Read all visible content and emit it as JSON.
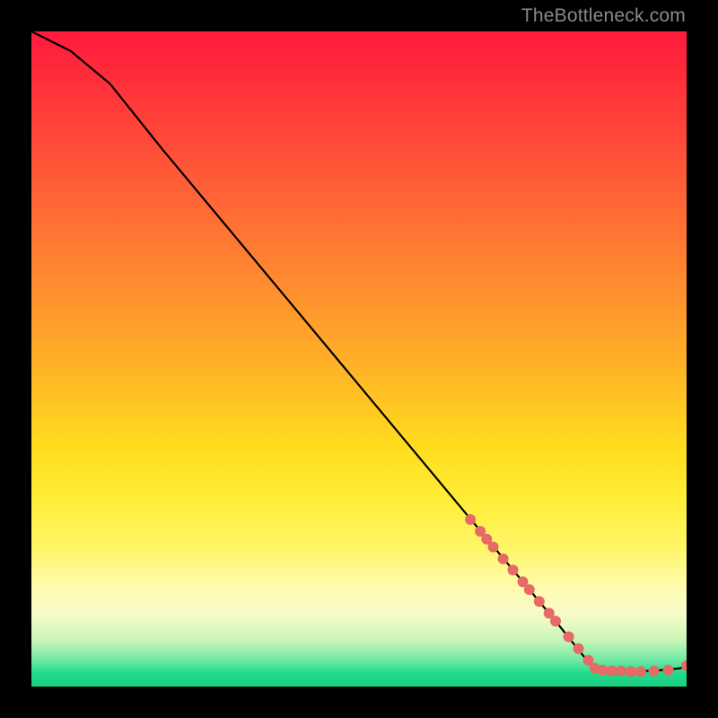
{
  "watermark": "TheBottleneck.com",
  "chart_data": {
    "type": "line",
    "title": "",
    "xlabel": "",
    "ylabel": "",
    "xlim": [
      0,
      100
    ],
    "ylim": [
      0,
      100
    ],
    "curve": [
      {
        "x": 0,
        "y": 100
      },
      {
        "x": 6,
        "y": 97
      },
      {
        "x": 12,
        "y": 92
      },
      {
        "x": 20,
        "y": 82
      },
      {
        "x": 30,
        "y": 70
      },
      {
        "x": 40,
        "y": 58
      },
      {
        "x": 50,
        "y": 46
      },
      {
        "x": 60,
        "y": 34
      },
      {
        "x": 70,
        "y": 22
      },
      {
        "x": 80,
        "y": 10
      },
      {
        "x": 86,
        "y": 2.5
      },
      {
        "x": 90,
        "y": 2.4
      },
      {
        "x": 95,
        "y": 2.4
      },
      {
        "x": 99,
        "y": 2.8
      },
      {
        "x": 100,
        "y": 3.2
      }
    ],
    "markers": [
      {
        "x": 67,
        "y": 25.5
      },
      {
        "x": 68.5,
        "y": 23.7
      },
      {
        "x": 69.5,
        "y": 22.5
      },
      {
        "x": 70.5,
        "y": 21.3
      },
      {
        "x": 72,
        "y": 19.5
      },
      {
        "x": 73.5,
        "y": 17.8
      },
      {
        "x": 75,
        "y": 16
      },
      {
        "x": 76,
        "y": 14.8
      },
      {
        "x": 77.5,
        "y": 13
      },
      {
        "x": 79,
        "y": 11.2
      },
      {
        "x": 80,
        "y": 10
      },
      {
        "x": 82,
        "y": 7.6
      },
      {
        "x": 83.5,
        "y": 5.8
      },
      {
        "x": 85,
        "y": 4.0
      },
      {
        "x": 86,
        "y": 2.8
      },
      {
        "x": 87.2,
        "y": 2.5
      },
      {
        "x": 88.6,
        "y": 2.4
      },
      {
        "x": 90,
        "y": 2.4
      },
      {
        "x": 91.5,
        "y": 2.3
      },
      {
        "x": 93,
        "y": 2.3
      },
      {
        "x": 95,
        "y": 2.4
      },
      {
        "x": 97.2,
        "y": 2.5
      },
      {
        "x": 100,
        "y": 3.2
      }
    ],
    "marker_color": "#e66a65",
    "marker_radius_px": 6
  }
}
